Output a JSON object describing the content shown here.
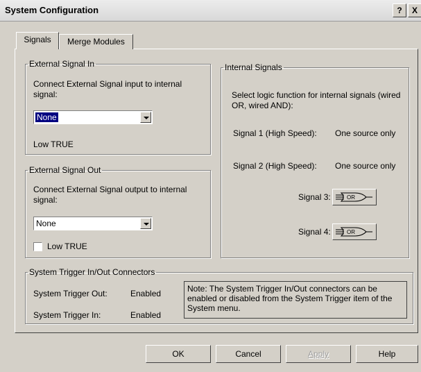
{
  "window": {
    "title": "System Configuration",
    "help_glyph": "?",
    "close_glyph": "X"
  },
  "tabs": [
    {
      "label": "Signals",
      "active": true
    },
    {
      "label": "Merge Modules",
      "active": false
    }
  ],
  "external_signal_in": {
    "legend": "External Signal In",
    "description": "Connect External Signal input to internal signal:",
    "selected_value": "None",
    "low_true_text": "Low TRUE"
  },
  "external_signal_out": {
    "legend": "External Signal Out",
    "description": "Connect External Signal output to internal signal:",
    "selected_value": "None",
    "low_true_label": "Low TRUE",
    "low_true_checked": false
  },
  "internal_signals": {
    "legend": "Internal Signals",
    "description": "Select logic function for internal signals (wired OR, wired AND):",
    "rows": [
      {
        "name": "Signal 1 (High Speed):",
        "value": "One source only"
      },
      {
        "name": "Signal 2 (High Speed):",
        "value": "One source only"
      }
    ],
    "gates": [
      {
        "name": "Signal 3:",
        "gate": "OR",
        "icon": "or-gate-icon"
      },
      {
        "name": "Signal 4:",
        "gate": "OR",
        "icon": "or-gate-icon"
      }
    ]
  },
  "system_trigger": {
    "legend": "System Trigger In/Out Connectors",
    "rows": [
      {
        "label": "System Trigger Out:",
        "value": "Enabled"
      },
      {
        "label": "System Trigger In:",
        "value": "Enabled"
      }
    ],
    "note": "Note: The System Trigger In/Out connectors can be enabled or disabled from the System Trigger item of the System menu."
  },
  "buttons": {
    "ok": "OK",
    "cancel": "Cancel",
    "apply": "Apply",
    "help": "Help"
  },
  "colors": {
    "dialog_bg": "#d4d0c8",
    "selection": "#000080"
  }
}
